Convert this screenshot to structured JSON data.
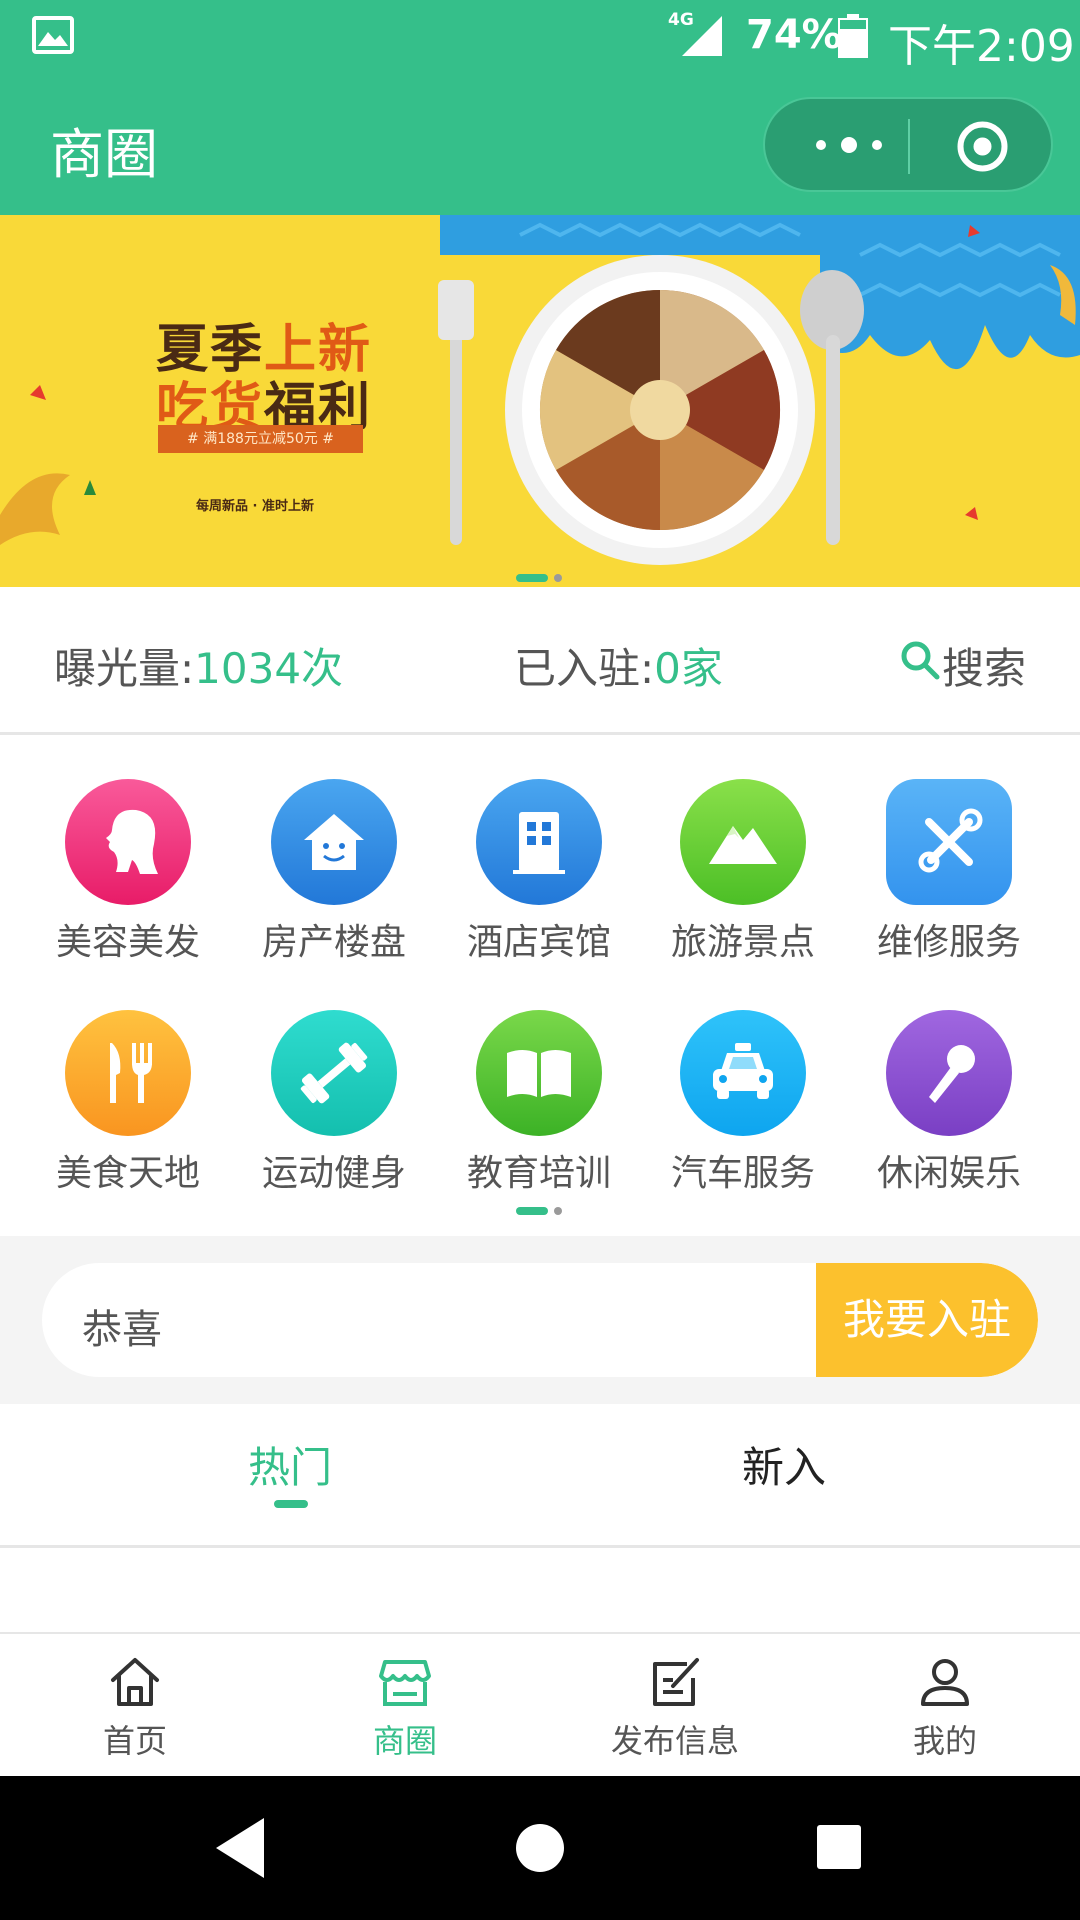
{
  "status_bar": {
    "network": "4G",
    "battery": "74%",
    "time": "下午2:09",
    "icons": [
      "photo-icon",
      "signal-icon",
      "battery-icon"
    ]
  },
  "title_bar": {
    "title": "商圈",
    "capsule": [
      "more-icon",
      "close-target-icon"
    ]
  },
  "banner": {
    "line1_a": "夏季",
    "line1_b": "上新",
    "line2_a": "吃货",
    "line2_b": "福利",
    "tag": "# 满188元立减50元 #",
    "sub": "每周新品 · 准时上新",
    "pages": 2,
    "active_page": 1
  },
  "stats": {
    "exposure_label": "曝光量:",
    "exposure_value": "1034次",
    "joined_label": "已入驻:",
    "joined_value": "0家",
    "search_label": "搜索"
  },
  "categories": [
    {
      "label": "美容美发",
      "icon": "beauty-icon",
      "color": "#f0317c"
    },
    {
      "label": "房产楼盘",
      "icon": "house-icon",
      "color": "#2f8fe6"
    },
    {
      "label": "酒店宾馆",
      "icon": "hotel-icon",
      "color": "#2f8fe6"
    },
    {
      "label": "旅游景点",
      "icon": "mountain-icon",
      "color": "#5fcd32"
    },
    {
      "label": "维修服务",
      "icon": "tools-icon",
      "color": "#3aa2f5"
    },
    {
      "label": "美食天地",
      "icon": "cutlery-icon",
      "color": "#fca92a"
    },
    {
      "label": "运动健身",
      "icon": "dumbbell-icon",
      "color": "#1fcdc0"
    },
    {
      "label": "教育培训",
      "icon": "book-icon",
      "color": "#55c52d"
    },
    {
      "label": "汽车服务",
      "icon": "taxi-icon",
      "color": "#16b4f5"
    },
    {
      "label": "休闲娱乐",
      "icon": "microphone-icon",
      "color": "#8b50cf"
    }
  ],
  "join": {
    "text": "恭喜",
    "button": "我要入驻"
  },
  "tabs": [
    {
      "label": "热门",
      "active": true
    },
    {
      "label": "新入",
      "active": false
    }
  ],
  "bottom_nav": [
    {
      "label": "首页",
      "icon": "home-icon",
      "active": false
    },
    {
      "label": "商圈",
      "icon": "store-icon",
      "active": true
    },
    {
      "label": "发布信息",
      "icon": "edit-icon",
      "active": false
    },
    {
      "label": "我的",
      "icon": "user-icon",
      "active": false
    }
  ],
  "colors": {
    "primary": "#35bf8a",
    "accent": "#fcc12d",
    "banner_bg": "#f9d938"
  }
}
